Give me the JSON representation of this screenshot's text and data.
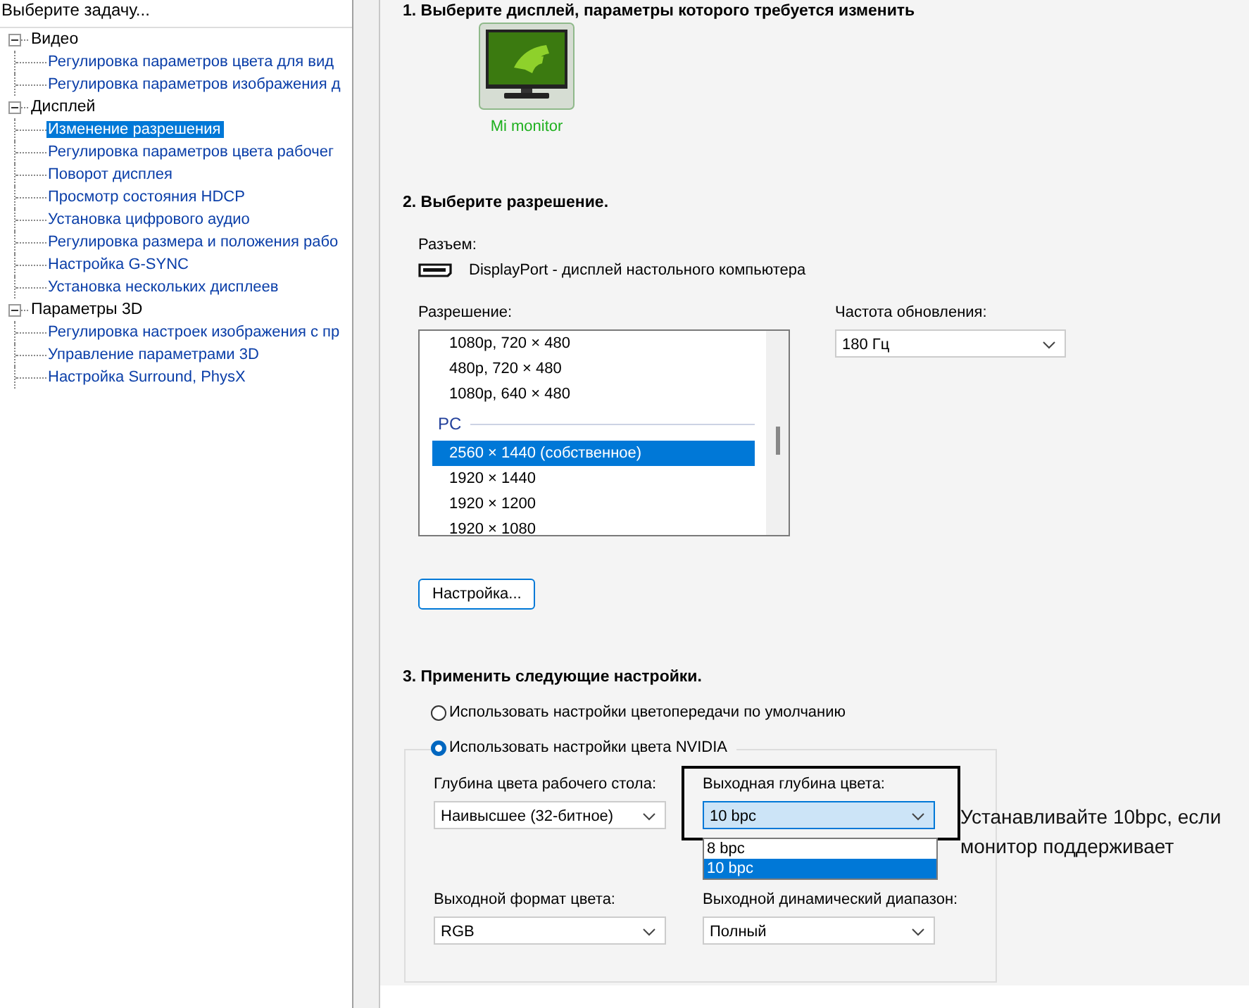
{
  "task_panel": {
    "title": "Выберите задачу...",
    "tree": [
      {
        "label": "Видео",
        "expanded": true,
        "children": [
          {
            "label": "Регулировка параметров цвета для вид",
            "selected": false
          },
          {
            "label": "Регулировка параметров изображения д",
            "selected": false
          }
        ]
      },
      {
        "label": "Дисплей",
        "expanded": true,
        "children": [
          {
            "label": "Изменение разрешения",
            "selected": true
          },
          {
            "label": "Регулировка параметров цвета рабочег",
            "selected": false
          },
          {
            "label": "Поворот дисплея",
            "selected": false
          },
          {
            "label": "Просмотр состояния HDCP",
            "selected": false
          },
          {
            "label": "Установка цифрового аудио",
            "selected": false
          },
          {
            "label": "Регулировка размера и положения рабо",
            "selected": false
          },
          {
            "label": "Настройка G-SYNC",
            "selected": false
          },
          {
            "label": "Установка нескольких дисплеев",
            "selected": false
          }
        ]
      },
      {
        "label": "Параметры 3D",
        "expanded": true,
        "children": [
          {
            "label": "Регулировка настроек изображения с пр",
            "selected": false
          },
          {
            "label": "Управление параметрами 3D",
            "selected": false
          },
          {
            "label": "Настройка Surround, PhysX",
            "selected": false
          }
        ]
      }
    ]
  },
  "step1": {
    "heading": "1. Выберите дисплей, параметры которого требуется изменить",
    "displays": [
      {
        "name": "Mi monitor",
        "selected": true
      }
    ]
  },
  "step2": {
    "heading": "2. Выберите разрешение.",
    "connector_label": "Разъем:",
    "connector": "DisplayPort - дисплей настольного компьютера",
    "resolution_label": "Разрешение:",
    "resolutions": [
      {
        "kind": "item",
        "label": "1080p, 720 × 480",
        "selected": false
      },
      {
        "kind": "item",
        "label": "480p, 720 × 480",
        "selected": false
      },
      {
        "kind": "item",
        "label": "1080p, 640 × 480",
        "selected": false
      },
      {
        "kind": "group",
        "label": "PC"
      },
      {
        "kind": "item",
        "label": "2560 × 1440 (собственное)",
        "selected": true
      },
      {
        "kind": "item",
        "label": "1920 × 1440",
        "selected": false
      },
      {
        "kind": "item",
        "label": "1920 × 1200",
        "selected": false
      },
      {
        "kind": "item",
        "label": "1920 × 1080",
        "selected": false
      }
    ],
    "refresh_label": "Частота обновления:",
    "refresh_value": "180 Гц",
    "customize_button": "Настройка..."
  },
  "step3": {
    "heading": "3. Применить следующие настройки.",
    "options": [
      {
        "label": "Использовать настройки цветопередачи по умолчанию",
        "selected": false
      },
      {
        "label": "Использовать настройки цвета NVIDIA",
        "selected": true
      }
    ],
    "desktop_depth": {
      "label": "Глубина цвета рабочего стола:",
      "value": "Наивысшее (32-битное)"
    },
    "output_depth": {
      "label": "Выходная глубина цвета:",
      "value": "10 bpc",
      "expanded": true,
      "options": [
        {
          "label": "8 bpc",
          "selected": false
        },
        {
          "label": "10 bpc",
          "selected": true
        }
      ]
    },
    "output_format": {
      "label": "Выходной формат цвета:",
      "value": "RGB"
    },
    "dynamic_range": {
      "label": "Выходной динамический диапазон:",
      "value": "Полный"
    }
  },
  "annotation": {
    "text": "Устанавливайте 10bpc, если монитор поддерживает"
  }
}
